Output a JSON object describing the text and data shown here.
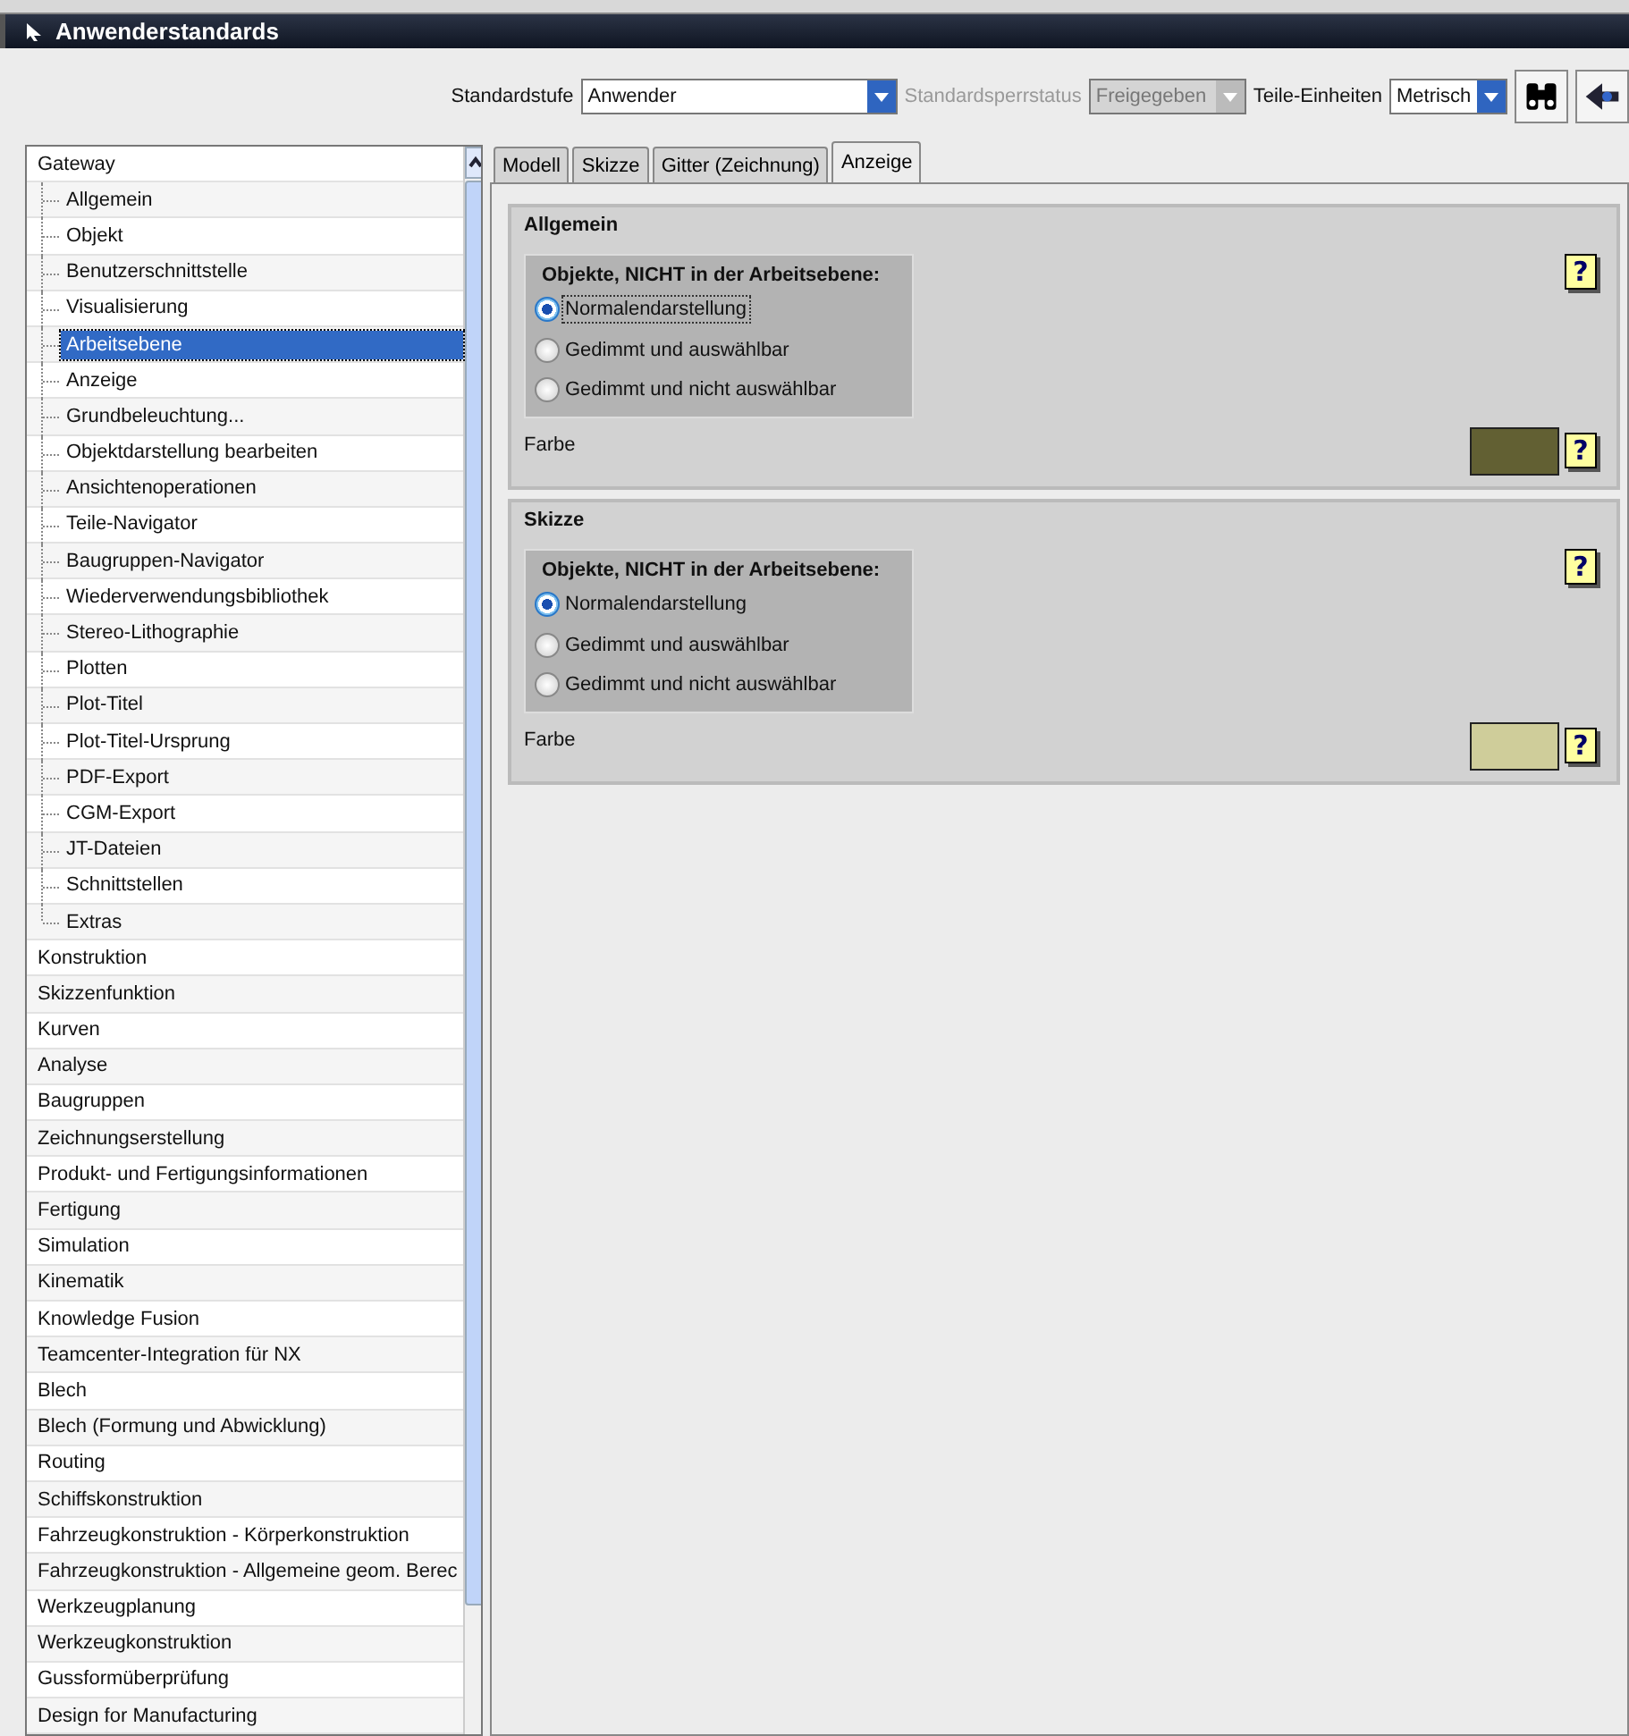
{
  "window": {
    "title": "Anwenderstandards"
  },
  "toolbar": {
    "standard_level": {
      "label": "Standardstufe",
      "value": "Anwender"
    },
    "lock_status": {
      "label": "Standardsperrstatus",
      "value": "Freigegeben",
      "disabled": true
    },
    "units": {
      "label": "Teile-Einheiten",
      "value": "Metrisch"
    }
  },
  "tree": [
    {
      "label": "Gateway",
      "selected": false,
      "children": [
        {
          "label": "Allgemein",
          "selected": false
        },
        {
          "label": "Objekt",
          "selected": false
        },
        {
          "label": "Benutzerschnittstelle",
          "selected": false
        },
        {
          "label": "Visualisierung",
          "selected": false
        },
        {
          "label": "Arbeitsebene",
          "selected": true
        },
        {
          "label": "Anzeige",
          "selected": false
        },
        {
          "label": "Grundbeleuchtung...",
          "selected": false
        },
        {
          "label": "Objektdarstellung bearbeiten",
          "selected": false
        },
        {
          "label": "Ansichtenoperationen",
          "selected": false
        },
        {
          "label": "Teile-Navigator",
          "selected": false
        },
        {
          "label": "Baugruppen-Navigator",
          "selected": false
        },
        {
          "label": "Wiederverwendungsbibliothek",
          "selected": false
        },
        {
          "label": "Stereo-Lithographie",
          "selected": false
        },
        {
          "label": "Plotten",
          "selected": false
        },
        {
          "label": "Plot-Titel",
          "selected": false
        },
        {
          "label": "Plot-Titel-Ursprung",
          "selected": false
        },
        {
          "label": "PDF-Export",
          "selected": false
        },
        {
          "label": "CGM-Export",
          "selected": false
        },
        {
          "label": "JT-Dateien",
          "selected": false
        },
        {
          "label": "Schnittstellen",
          "selected": false
        },
        {
          "label": "Extras",
          "selected": false
        }
      ]
    },
    {
      "label": "Konstruktion",
      "selected": false
    },
    {
      "label": "Skizzenfunktion",
      "selected": false
    },
    {
      "label": "Kurven",
      "selected": false
    },
    {
      "label": "Analyse",
      "selected": false
    },
    {
      "label": "Baugruppen",
      "selected": false
    },
    {
      "label": "Zeichnungserstellung",
      "selected": false
    },
    {
      "label": "Produkt- und Fertigungsinformationen",
      "selected": false
    },
    {
      "label": "Fertigung",
      "selected": false
    },
    {
      "label": "Simulation",
      "selected": false
    },
    {
      "label": "Kinematik",
      "selected": false
    },
    {
      "label": "Knowledge Fusion",
      "selected": false
    },
    {
      "label": "Teamcenter-Integration für NX",
      "selected": false
    },
    {
      "label": "Blech",
      "selected": false
    },
    {
      "label": "Blech (Formung und Abwicklung)",
      "selected": false
    },
    {
      "label": "Routing",
      "selected": false
    },
    {
      "label": "Schiffskonstruktion",
      "selected": false
    },
    {
      "label": "Fahrzeugkonstruktion - Körperkonstruktion",
      "selected": false
    },
    {
      "label": "Fahrzeugkonstruktion - Allgemeine geom. Berec",
      "selected": false
    },
    {
      "label": "Werkzeugplanung",
      "selected": false
    },
    {
      "label": "Werkzeugkonstruktion",
      "selected": false
    },
    {
      "label": "Gussformüberprüfung",
      "selected": false
    },
    {
      "label": "Design for Manufacturing",
      "selected": false
    }
  ],
  "tabs": [
    {
      "label": "Modell",
      "selected": false
    },
    {
      "label": "Skizze",
      "selected": false
    },
    {
      "label": "Gitter (Zeichnung)",
      "selected": false
    },
    {
      "label": "Anzeige",
      "selected": true
    }
  ],
  "sections": [
    {
      "title": "Allgemein",
      "group_title": "Objekte, NICHT in der Arbeitsebene:",
      "options": [
        {
          "label": "Normalendarstellung",
          "selected": true
        },
        {
          "label": "Gedimmt und auswählbar",
          "selected": false
        },
        {
          "label": "Gedimmt und nicht auswählbar",
          "selected": false
        }
      ],
      "color_label": "Farbe",
      "color": "#626033",
      "help_mark": "?",
      "color_help_mark": "?"
    },
    {
      "title": "Skizze",
      "group_title": "Objekte, NICHT in der Arbeitsebene:",
      "options": [
        {
          "label": "Normalendarstellung",
          "selected": true
        },
        {
          "label": "Gedimmt und auswählbar",
          "selected": false
        },
        {
          "label": "Gedimmt und nicht auswählbar",
          "selected": false
        }
      ],
      "color_label": "Farbe",
      "color": "#cfcd9a",
      "help_mark": "?",
      "color_help_mark": "?"
    }
  ]
}
